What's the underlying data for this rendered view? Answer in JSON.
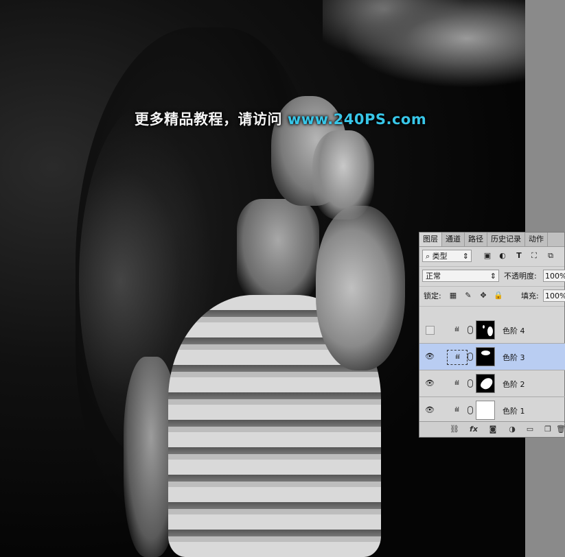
{
  "watermark": {
    "cn": "更多精品教程，请访问 ",
    "url": "www.240PS.com"
  },
  "panel": {
    "tabs": [
      "图层",
      "通道",
      "路径",
      "历史记录",
      "动作"
    ],
    "filter_kind": "类型",
    "blend_mode": "正常",
    "opacity_label": "不透明度:",
    "opacity_value": "100%",
    "lock_label": "锁定:",
    "fill_label": "填充:",
    "fill_value": "100%",
    "layers": [
      {
        "name": "色阶 4",
        "visible": false,
        "selected": false
      },
      {
        "name": "色阶 3",
        "visible": true,
        "selected": true
      },
      {
        "name": "色阶 2",
        "visible": true,
        "selected": false
      },
      {
        "name": "色阶 1",
        "visible": true,
        "selected": false
      }
    ],
    "icons": [
      "search-icon",
      "image-filter-icon",
      "adjust-filter-icon",
      "type-filter-icon",
      "shape-filter-icon",
      "smart-filter-icon",
      "lock-pixels-icon",
      "brush-icon",
      "move-icon",
      "lock-icon",
      "eye-icon",
      "levels-icon",
      "link-icon",
      "fx-icon",
      "mask-icon",
      "adjustment-icon",
      "folder-icon",
      "new-layer-icon",
      "trash-icon"
    ]
  }
}
